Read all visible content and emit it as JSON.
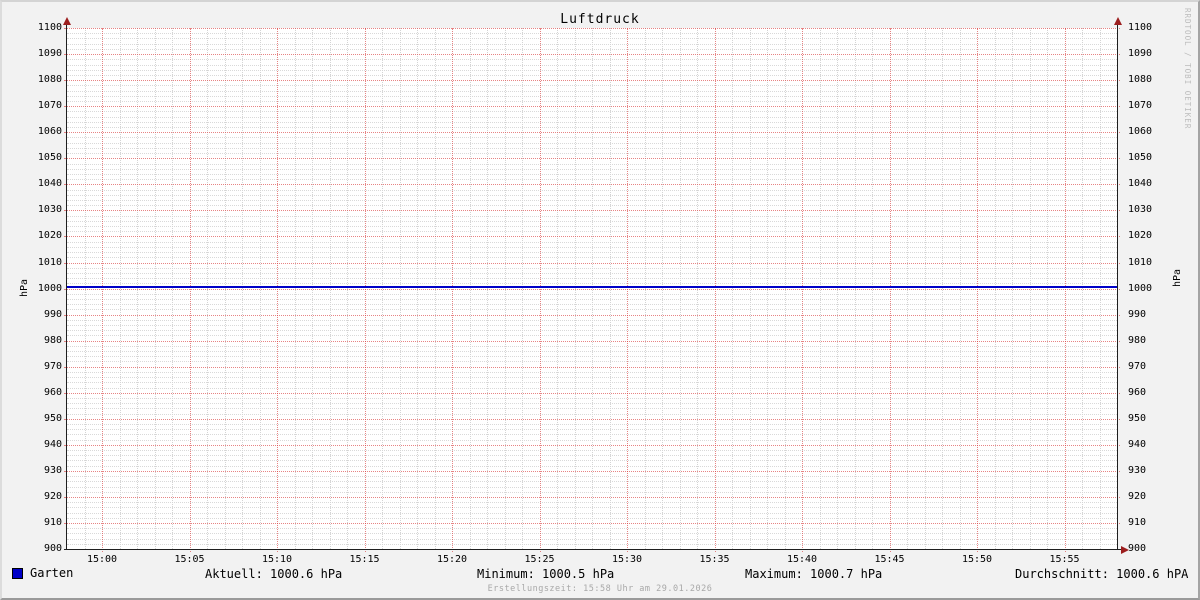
{
  "title": "Luftdruck",
  "watermark": "RRDTOOL / TOBI OETIKER",
  "footer": "Erstellungszeit: 15:58 Uhr am 29.01.2026",
  "axis": {
    "unit_left": "hPa",
    "unit_right": "hPa"
  },
  "legend": {
    "series_label": "Garten",
    "series_color": "#0000c8",
    "stats": [
      {
        "label": "Aktuell: 1000.6 hPa"
      },
      {
        "label": "Minimum: 1000.5 hPa"
      },
      {
        "label": "Maximum: 1000.7 hPa"
      },
      {
        "label": "Durchschnitt: 1000.6 hPA"
      }
    ]
  },
  "chart_data": {
    "type": "line",
    "title": "Luftdruck",
    "xlabel": "",
    "ylabel": "hPa",
    "ylim": [
      900,
      1100
    ],
    "y_tick_step": 10,
    "y_minor_step": 2,
    "y_tick_labels": [
      "900",
      "910",
      "920",
      "930",
      "940",
      "950",
      "960",
      "970",
      "980",
      "990",
      "1000",
      "1010",
      "1020",
      "1030",
      "1040",
      "1050",
      "1060",
      "1070",
      "1080",
      "1090",
      "1100"
    ],
    "x_range_minutes": 60,
    "x_start": "14:58",
    "x_end": "15:58",
    "x_tick_labels": [
      "15:00",
      "15:05",
      "15:10",
      "15:15",
      "15:20",
      "15:25",
      "15:30",
      "15:35",
      "15:40",
      "15:45",
      "15:50",
      "15:55"
    ],
    "x_first_tick_offset_min": 2,
    "x_tick_step_min": 5,
    "x_minor_step_min": 1,
    "grid": true,
    "legend_position": "bottom",
    "series": [
      {
        "name": "Garten",
        "color": "#0000c8",
        "shape": "flat-line",
        "value": 1000.6,
        "stats": {
          "aktuell": 1000.6,
          "minimum": 1000.5,
          "maximum": 1000.7,
          "durchschnitt": 1000.6,
          "unit": "hPa"
        }
      }
    ]
  }
}
